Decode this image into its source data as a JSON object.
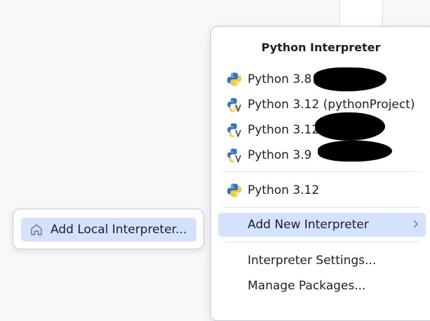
{
  "popup": {
    "title": "Python Interpreter",
    "interpreters": [
      {
        "label": "Python 3.8",
        "icon": "python-icon"
      },
      {
        "label": "Python 3.12 (pythonProject)",
        "icon": "python-venv-icon"
      },
      {
        "label": "Python 3.12",
        "icon": "python-venv-icon"
      },
      {
        "label": "Python 3.9",
        "icon": "python-venv-icon"
      }
    ],
    "system_interpreter": {
      "label": "Python 3.12",
      "icon": "python-icon"
    },
    "add_new": {
      "label": "Add New Interpreter",
      "icon": "chevron-right-icon"
    },
    "settings_label": "Interpreter Settings...",
    "manage_label": "Manage Packages..."
  },
  "submenu": {
    "add_local": {
      "label": "Add Local Interpreter...",
      "icon": "home-icon"
    }
  },
  "colors": {
    "selection": "#d4e2ff",
    "python_blue": "#3a74b8",
    "python_yellow": "#f5c83b"
  }
}
